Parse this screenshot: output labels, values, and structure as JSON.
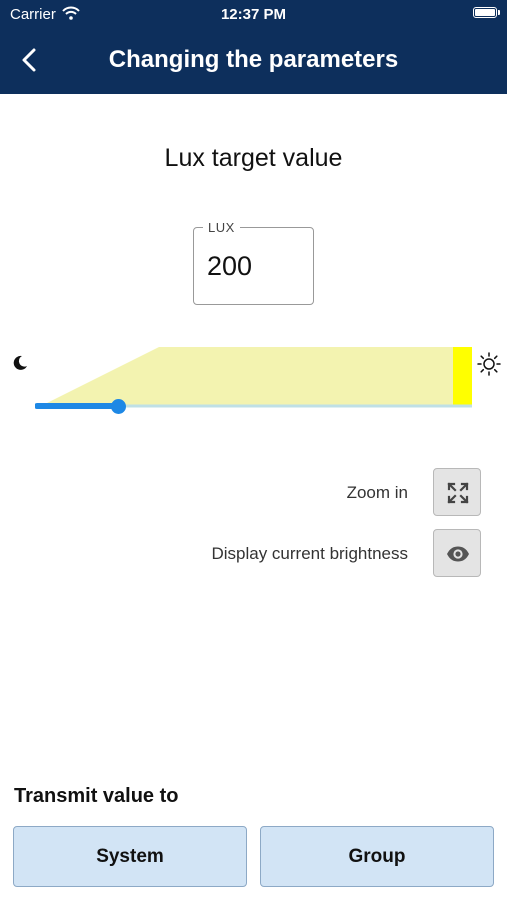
{
  "status_bar": {
    "carrier": "Carrier",
    "time": "12:37 PM",
    "icons": [
      "wifi-icon",
      "battery-icon"
    ]
  },
  "nav": {
    "back_icon": "chevron-left-icon",
    "title": "Changing the parameters"
  },
  "main": {
    "heading": "Lux target value",
    "lux_field": {
      "legend": "LUX",
      "value": "200"
    },
    "slider": {
      "left_icon": "moon-icon",
      "right_icon": "sun-icon",
      "value_fraction": 0.18,
      "track_color": "#1e88e5",
      "fill_color": "#f3f3b0",
      "marker_color": "#ffff00"
    },
    "options": [
      {
        "label": "Zoom in",
        "icon": "expand-icon"
      },
      {
        "label": "Display current brightness",
        "icon": "eye-icon"
      }
    ]
  },
  "transmit": {
    "label": "Transmit value to",
    "buttons": [
      "System",
      "Group"
    ]
  },
  "colors": {
    "header_bg": "#0d2f5c",
    "button_bg": "#d2e4f5"
  }
}
